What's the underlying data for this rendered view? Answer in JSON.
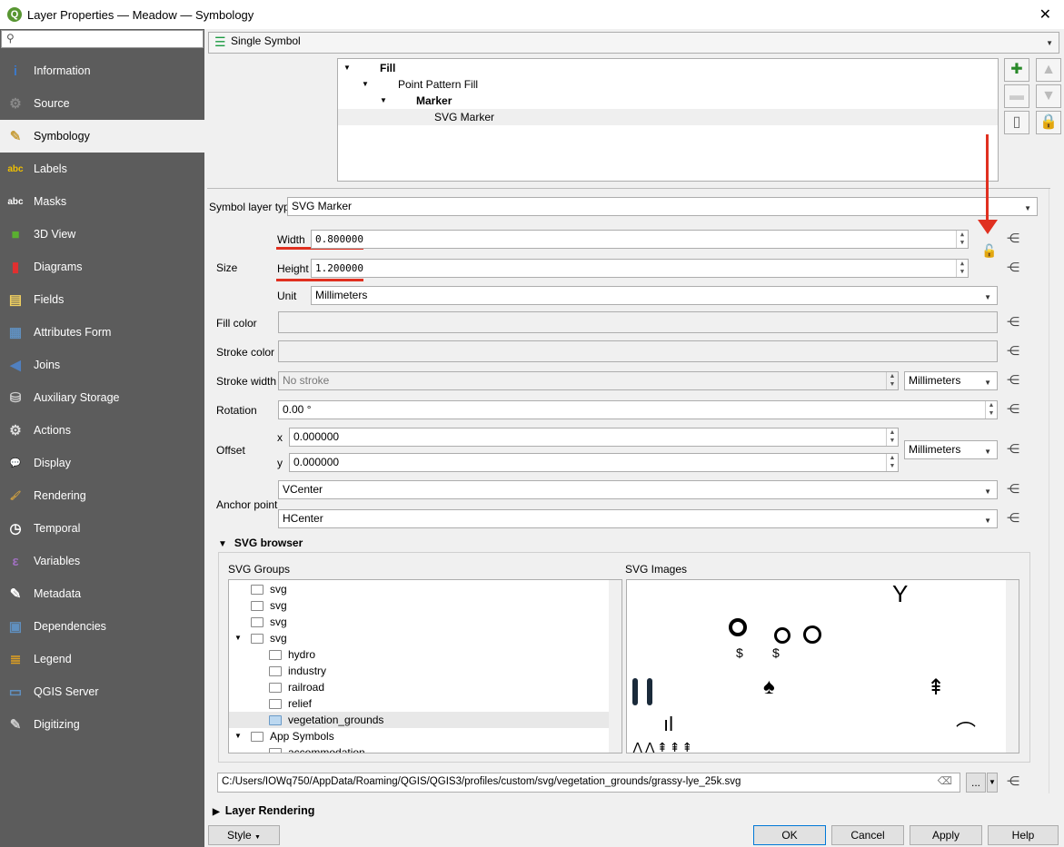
{
  "window": {
    "title": "Layer Properties — Meadow — Symbology",
    "close": "✕"
  },
  "sidebar": {
    "search_placeholder": "",
    "items": [
      {
        "label": "Information",
        "icon": "information-icon",
        "glyph": "i",
        "color": "#3c78c8"
      },
      {
        "label": "Source",
        "icon": "source-icon",
        "glyph": "⚙",
        "color": "#888"
      },
      {
        "label": "Symbology",
        "icon": "symbology-icon",
        "glyph": "✎",
        "color": "#c8a040"
      },
      {
        "label": "Labels",
        "icon": "labels-icon",
        "glyph": "abc",
        "color": "#f0c000"
      },
      {
        "label": "Masks",
        "icon": "masks-icon",
        "glyph": "abc",
        "color": "#fff"
      },
      {
        "label": "3D View",
        "icon": "3d-view-icon",
        "glyph": "■",
        "color": "#5ab030"
      },
      {
        "label": "Diagrams",
        "icon": "diagrams-icon",
        "glyph": "▮",
        "color": "#e03030"
      },
      {
        "label": "Fields",
        "icon": "fields-icon",
        "glyph": "▤",
        "color": "#f0d060"
      },
      {
        "label": "Attributes Form",
        "icon": "attributes-form-icon",
        "glyph": "▦",
        "color": "#6090c0"
      },
      {
        "label": "Joins",
        "icon": "joins-icon",
        "glyph": "◀",
        "color": "#5080c0"
      },
      {
        "label": "Auxiliary Storage",
        "icon": "auxiliary-storage-icon",
        "glyph": "⛁",
        "color": "#ccc"
      },
      {
        "label": "Actions",
        "icon": "actions-icon",
        "glyph": "⚙",
        "color": "#ddd"
      },
      {
        "label": "Display",
        "icon": "display-icon",
        "glyph": "💬",
        "color": "#f0e060"
      },
      {
        "label": "Rendering",
        "icon": "rendering-icon",
        "glyph": "🖌",
        "color": "#d0a040"
      },
      {
        "label": "Temporal",
        "icon": "temporal-icon",
        "glyph": "◷",
        "color": "#fff"
      },
      {
        "label": "Variables",
        "icon": "variables-icon",
        "glyph": "ε",
        "color": "#a070c0"
      },
      {
        "label": "Metadata",
        "icon": "metadata-icon",
        "glyph": "✎",
        "color": "#fff"
      },
      {
        "label": "Dependencies",
        "icon": "dependencies-icon",
        "glyph": "▣",
        "color": "#6090c0"
      },
      {
        "label": "Legend",
        "icon": "legend-icon",
        "glyph": "≣",
        "color": "#e0a020"
      },
      {
        "label": "QGIS Server",
        "icon": "qgis-server-icon",
        "glyph": "▭",
        "color": "#6090c0"
      },
      {
        "label": "Digitizing",
        "icon": "digitizing-icon",
        "glyph": "✎",
        "color": "#ccc"
      }
    ],
    "selected": 2
  },
  "renderer": {
    "value": "Single Symbol"
  },
  "symbol_tree": [
    "Fill",
    "Point Pattern Fill",
    "Marker",
    "SVG Marker"
  ],
  "form": {
    "symbol_layer_type_label": "Symbol layer type",
    "symbol_layer_type": "SVG Marker",
    "size_label": "Size",
    "width_label": "Width",
    "width": "0.800000",
    "height_label": "Height",
    "height": "1.200000",
    "unit_label": "Unit",
    "unit": "Millimeters",
    "fill_color_label": "Fill color",
    "stroke_color_label": "Stroke color",
    "stroke_width_label": "Stroke width",
    "stroke_width": "No stroke",
    "stroke_unit": "Millimeters",
    "rotation_label": "Rotation",
    "rotation": "0.00 °",
    "offset_label": "Offset",
    "x_label": "x",
    "x": "0.000000",
    "y_label": "y",
    "y": "0.000000",
    "offset_unit": "Millimeters",
    "anchor_label": "Anchor point",
    "anchor_v": "VCenter",
    "anchor_h": "HCenter"
  },
  "svg_browser": {
    "title": "SVG browser",
    "groups_label": "SVG Groups",
    "images_label": "SVG Images",
    "groups": [
      {
        "label": "svg",
        "level": 0,
        "arrow": ""
      },
      {
        "label": "svg",
        "level": 0,
        "arrow": ""
      },
      {
        "label": "svg",
        "level": 0,
        "arrow": ""
      },
      {
        "label": "svg",
        "level": 0,
        "arrow": "▼"
      },
      {
        "label": "hydro",
        "level": 1,
        "arrow": ""
      },
      {
        "label": "industry",
        "level": 1,
        "arrow": ""
      },
      {
        "label": "railroad",
        "level": 1,
        "arrow": ""
      },
      {
        "label": "relief",
        "level": 1,
        "arrow": ""
      },
      {
        "label": "vegetation_grounds",
        "level": 1,
        "arrow": "",
        "selected": true
      },
      {
        "label": "App Symbols",
        "level": 0,
        "arrow": "▼"
      },
      {
        "label": "accommodation",
        "level": 1,
        "arrow": ""
      }
    ],
    "path": "C:/Users/IOWq750/AppData/Roaming/QGIS/QGIS3/profiles/custom/svg/vegetation_grounds/grassy-lye_25k.svg",
    "browse": "..."
  },
  "layer_rendering": "Layer Rendering",
  "footer": {
    "style": "Style",
    "ok": "OK",
    "cancel": "Cancel",
    "apply": "Apply",
    "help": "Help"
  },
  "colors": {
    "sidebar": "#5c5c5c",
    "annotation": "#e03020"
  }
}
